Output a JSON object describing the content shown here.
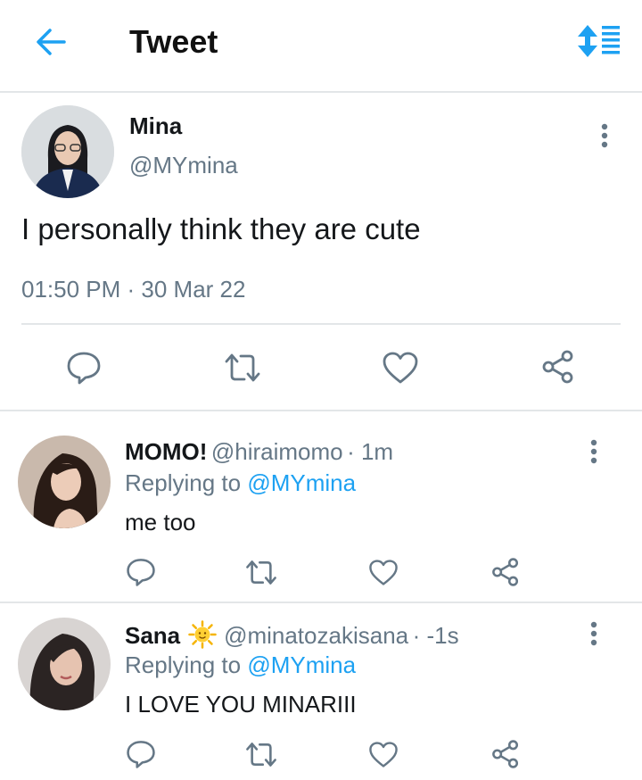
{
  "header": {
    "title": "Tweet"
  },
  "tweet": {
    "name": "Mina",
    "handle": "@MYmina",
    "text": "I personally think they are cute",
    "timestamp": "01:50 PM · 30 Mar 22"
  },
  "replies": [
    {
      "name": "MOMO!",
      "handle": "@hiraimomo",
      "time": "· 1m",
      "replying_label": "Replying to",
      "replying_to": "@MYmina",
      "text": "me too"
    },
    {
      "name": "Sana",
      "emoji": "sun-with-face",
      "handle": "@minatozakisana",
      "time": "· -1s",
      "replying_label": "Replying to",
      "replying_to": "@MYmina",
      "text": "I LOVE YOU MINARIII"
    }
  ],
  "colors": {
    "accent": "#1da1f2",
    "muted": "#657786",
    "divider": "#e3e6e8",
    "icon": "#657786"
  }
}
